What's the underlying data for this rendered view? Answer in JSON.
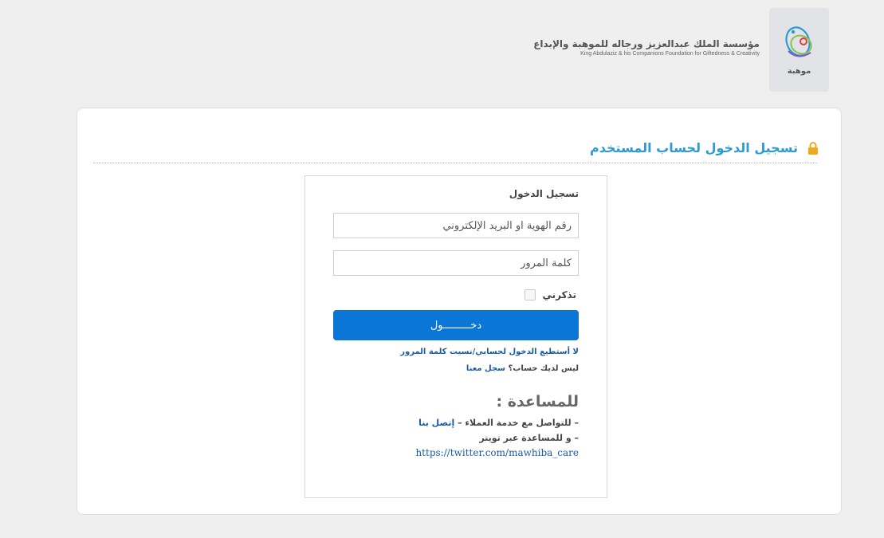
{
  "header": {
    "logo_word": "موهبة",
    "org_name_ar": "مؤسسة الملك عبدالعزيز ورجاله للموهبة والإبداع",
    "org_name_en": "King Abdulaziz & his Companions Foundation for Giftedness & Creativity"
  },
  "card": {
    "title": "تسجيل الدخول لحساب المستخدم"
  },
  "login": {
    "heading": "تسجيل الدخول",
    "id_placeholder": "رقم الهوية او البريد الإلكتروني",
    "password_placeholder": "كلمة المرور",
    "remember_label": "تذكرني",
    "submit_label": "دخـــــــــول",
    "forgot_link": "لا أستطيع الدخول لحسابي/نسيت كلمة المرور",
    "no_account_text": "ليس لديك حساب؟",
    "register_link": "سجل معنا"
  },
  "help": {
    "title": "للمساعدة :",
    "contact_prefix": "– للتواصل مع خدمة العملاء –",
    "contact_link": "إتصل بنا",
    "twitter_prefix": "– و للمساعدة عبر تويتر",
    "twitter_url": "https://twitter.com/mawhiba_care"
  },
  "colors": {
    "accent": "#2d9ad6",
    "button": "#0c76d6",
    "link": "#1a5ba8",
    "lock": "#f0a81c"
  }
}
